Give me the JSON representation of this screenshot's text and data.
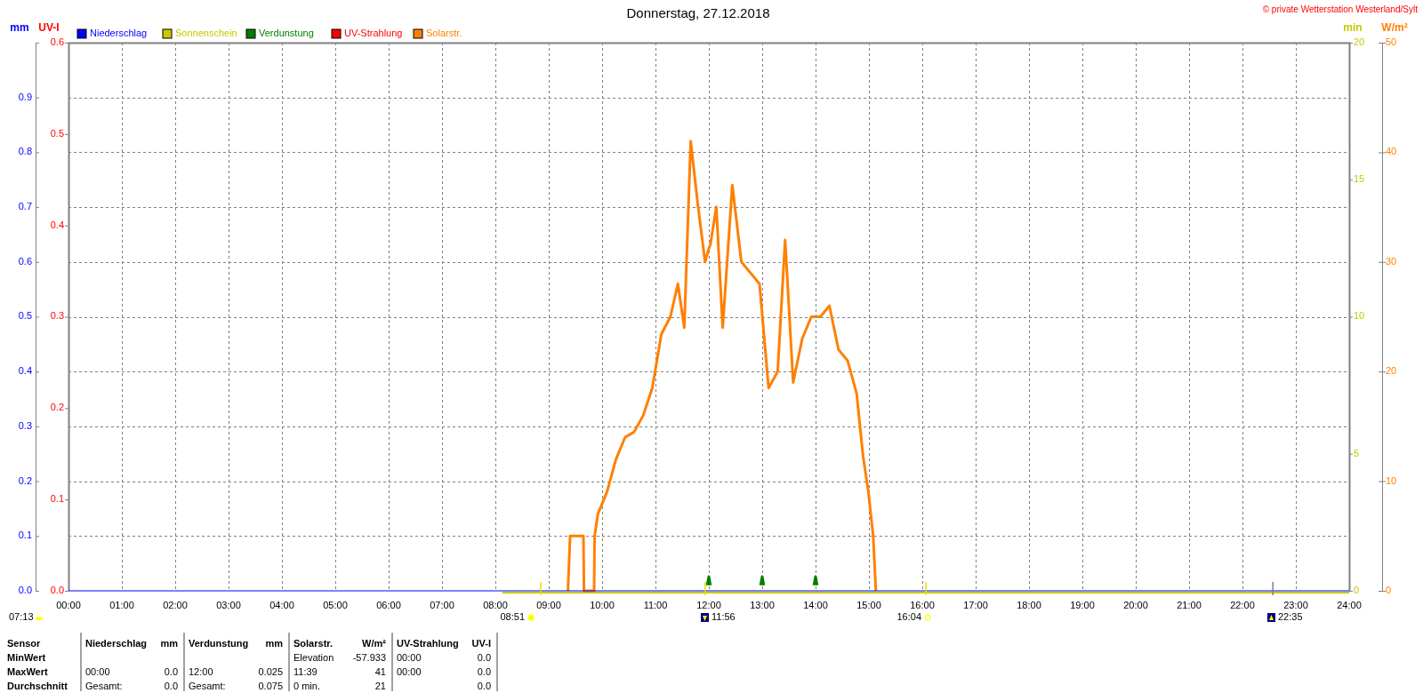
{
  "title": "Donnerstag, 27.12.2018",
  "copyright": "© private Wetterstation Westerland/Sylt",
  "chart": {
    "axes": [
      {
        "unit": "mm",
        "color": "#0000ff",
        "ticks": [
          "0.9",
          "0.8",
          "0.7",
          "0.6",
          "0.5",
          "0.4",
          "0.3",
          "0.2",
          "0.1",
          "0.0"
        ]
      },
      {
        "unit": "UV-I",
        "color": "#ff0000",
        "ticks": [
          "0.6",
          "0.5",
          "0.4",
          "0.3",
          "0.2",
          "0.1",
          "0.0"
        ]
      },
      {
        "unit": "min",
        "color": "#c8c800",
        "ticks": [
          "20",
          "15",
          "10",
          "5",
          "0"
        ]
      },
      {
        "unit": "W/m²",
        "color": "#ff8000"
      }
    ],
    "chart_data": {
      "type": "line",
      "legend": "top",
      "grid": true,
      "xlim": [
        0,
        24
      ],
      "ylim": [
        0,
        50
      ],
      "xticks": [
        {
          "value": 0,
          "label": "00:00"
        },
        {
          "value": 1,
          "label": "01:00"
        },
        {
          "value": 2,
          "label": "02:00"
        },
        {
          "value": 3,
          "label": "03:00"
        },
        {
          "value": 4,
          "label": "04:00"
        },
        {
          "value": 5,
          "label": "05:00"
        },
        {
          "value": 6,
          "label": "06:00"
        },
        {
          "value": 7,
          "label": "07:00"
        },
        {
          "value": 8,
          "label": "08:00"
        },
        {
          "value": 9,
          "label": "09:00"
        },
        {
          "value": 10,
          "label": "10:00"
        },
        {
          "value": 11,
          "label": "11:00"
        },
        {
          "value": 12,
          "label": "12:00"
        },
        {
          "value": 13,
          "label": "13:00"
        },
        {
          "value": 14,
          "label": "14:00"
        },
        {
          "value": 15,
          "label": "15:00"
        },
        {
          "value": 16,
          "label": "16:00"
        },
        {
          "value": 17,
          "label": "17:00"
        },
        {
          "value": 18,
          "label": "18:00"
        },
        {
          "value": 19,
          "label": "19:00"
        },
        {
          "value": 20,
          "label": "20:00"
        },
        {
          "value": 21,
          "label": "21:00"
        },
        {
          "value": 22,
          "label": "22:00"
        },
        {
          "value": 23,
          "label": "23:00"
        },
        {
          "value": 24,
          "label": "24:00"
        }
      ],
      "yticks": [
        50,
        40,
        30,
        20,
        10,
        0
      ],
      "x": [
        0,
        8.13,
        9.36,
        9.4,
        9.65,
        9.66,
        9.85,
        9.86,
        9.92,
        10.09,
        10.26,
        10.43,
        10.6,
        10.77,
        10.94,
        11.11,
        11.28,
        11.42,
        11.54,
        11.66,
        11.8,
        11.93,
        11.97,
        12,
        12.03,
        12.14,
        12.26,
        12.44,
        12.61,
        12.78,
        12.95,
        12.97,
        13,
        13.03,
        13.12,
        13.29,
        13.43,
        13.58,
        13.75,
        13.92,
        13.97,
        14,
        14.03,
        14.09,
        14.26,
        14.43,
        14.6,
        14.77,
        14.89,
        14.99,
        15.08,
        15.13,
        24
      ],
      "series": [
        {
          "name": "Niederschlag",
          "color": "#0000ff",
          "values": [
            0,
            0,
            0,
            0,
            0,
            0,
            0,
            0,
            0,
            0,
            0,
            0,
            0,
            0,
            0,
            0,
            0,
            0,
            0,
            0,
            0,
            0,
            0,
            0,
            0,
            0,
            0,
            0,
            0,
            0,
            0,
            0,
            0,
            0,
            0,
            0,
            0,
            0,
            0,
            0,
            0,
            0,
            0,
            0,
            0,
            0,
            0,
            0,
            0,
            0,
            0,
            0,
            0
          ]
        },
        {
          "name": "Sonnenschein",
          "color": "#c8c800",
          "values": [
            null,
            0,
            0,
            0,
            0,
            0,
            0,
            0,
            0,
            0,
            0,
            0,
            0,
            0,
            0,
            0,
            0,
            0,
            0,
            0,
            0,
            0,
            0,
            0,
            0,
            0,
            0,
            0,
            0,
            0,
            0,
            0,
            0,
            0,
            0,
            0,
            0,
            0,
            0,
            0,
            0,
            0,
            0,
            0,
            0,
            0,
            0,
            0,
            0,
            0,
            0,
            0,
            0
          ]
        },
        {
          "name": "Verdunstung",
          "color": "#008000",
          "values": [
            null,
            null,
            null,
            null,
            null,
            null,
            null,
            null,
            null,
            null,
            null,
            null,
            null,
            null,
            null,
            null,
            null,
            null,
            null,
            null,
            null,
            null,
            0.5,
            1.3,
            0.5,
            null,
            null,
            null,
            null,
            null,
            null,
            0.5,
            1.3,
            0.5,
            null,
            null,
            null,
            null,
            null,
            null,
            0.5,
            1.3,
            0.5,
            null,
            null,
            null,
            null,
            null,
            null,
            null,
            null,
            null,
            null
          ]
        },
        {
          "name": "UV-Strahlung",
          "color": "#ff0000",
          "values": [
            null,
            null,
            null,
            null,
            null,
            null,
            null,
            null,
            null,
            null,
            null,
            null,
            null,
            null,
            null,
            null,
            null,
            null,
            null,
            null,
            null,
            null,
            null,
            null,
            null,
            null,
            null,
            null,
            null,
            null,
            null,
            null,
            null,
            null,
            null,
            null,
            null,
            null,
            null,
            null,
            null,
            null,
            null,
            null,
            null,
            null,
            null,
            null,
            null,
            null,
            null,
            null,
            null
          ]
        },
        {
          "name": "Solarstr.",
          "color": "#ff8000",
          "values": [
            null,
            null,
            0,
            5,
            5,
            0,
            0,
            5,
            7,
            9,
            12,
            14,
            14.5,
            16,
            18.5,
            23.4,
            25,
            28,
            24,
            41,
            35,
            30,
            30.7,
            31.2,
            31.6,
            35,
            24,
            37,
            30,
            29,
            28,
            26.9,
            25.2,
            23.5,
            18.5,
            20,
            32,
            19,
            23,
            25,
            25,
            25,
            25,
            25,
            26,
            22,
            21,
            18,
            12.3,
            9,
            5,
            0,
            null
          ]
        }
      ]
    },
    "events": [
      {
        "time": "07:13",
        "kind": "sunrise"
      },
      {
        "time": "08:51",
        "kind": "sun"
      },
      {
        "time": "11:56",
        "kind": "noon"
      },
      {
        "time": "16:04",
        "kind": "sunset"
      },
      {
        "time": "22:35",
        "kind": "moon"
      }
    ]
  },
  "stats": {
    "columns": [
      "Sensor",
      "Niederschlag",
      "mm",
      "Verdunstung",
      "mm",
      "Solarstr.",
      "W/m²",
      "UV-Strahlung",
      "UV-I"
    ],
    "rows": [
      [
        "MinWert",
        "",
        "",
        "",
        "",
        "Elevation",
        "-57.933",
        "00:00",
        "0.0"
      ],
      [
        "MaxWert",
        "00:00",
        "0.0",
        "12:00",
        "0.025",
        "11:39",
        "41",
        "00:00",
        "0.0"
      ],
      [
        "Durchschnitt",
        "Gesamt:",
        "0.0",
        "Gesamt:",
        "0.075",
        "0 min.",
        "21",
        "",
        "0.0"
      ]
    ]
  }
}
